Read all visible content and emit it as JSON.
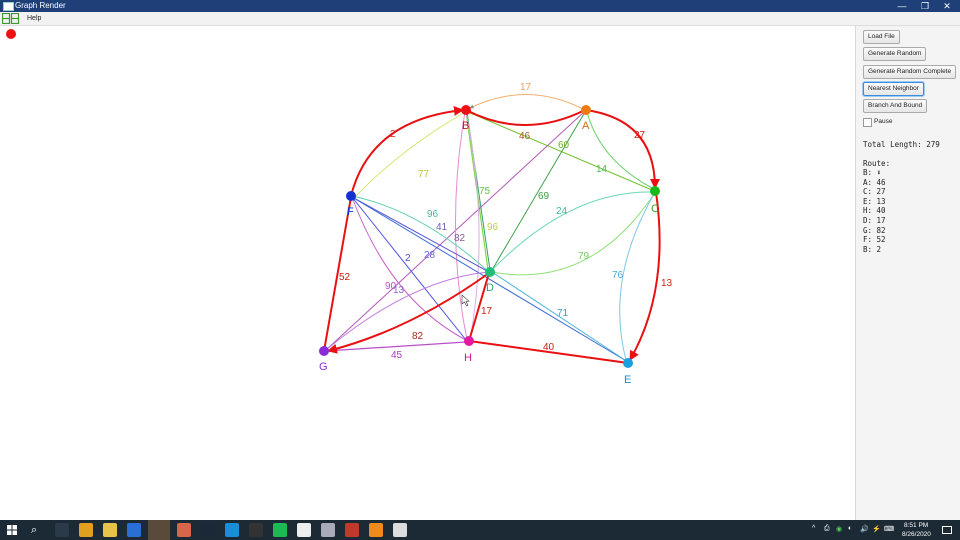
{
  "window": {
    "title": "Graph Render",
    "minimize_glyph": "—",
    "maximize_glyph": "❐",
    "close_glyph": "✕"
  },
  "menu": {
    "help": "Help"
  },
  "graph": {
    "nodes": [
      {
        "id": "B",
        "color": "#ee1111"
      },
      {
        "id": "A",
        "color": "#ef7a12"
      },
      {
        "id": "C",
        "color": "#1ab81a"
      },
      {
        "id": "F",
        "color": "#1530d0"
      },
      {
        "id": "D",
        "color": "#1fbf77"
      },
      {
        "id": "G",
        "color": "#8a2bd6"
      },
      {
        "id": "H",
        "color": "#e21aa0"
      },
      {
        "id": "E",
        "color": "#1a9fdf"
      }
    ],
    "edge_labels": [
      "17",
      "2",
      "46",
      "60",
      "27",
      "14",
      "77",
      "75",
      "69",
      "96",
      "41",
      "82",
      "96",
      "24",
      "2",
      "28",
      "79",
      "76",
      "52",
      "90",
      "13",
      "17",
      "82",
      "71",
      "13",
      "45",
      "40"
    ],
    "indicator_color": "#ee1111"
  },
  "panel": {
    "buttons": {
      "load_file": "Load File",
      "generate_random": "Generate Random",
      "generate_random_complete": "Generate Random Complete",
      "nearest_neighbor": "Nearest Neighbor",
      "branch_and_bound": "Branch And Bound"
    },
    "pause_label": "Pause",
    "pause_checked": false,
    "total_length_label": "Total Length:",
    "total_length": "279",
    "route_label": "Route:",
    "route": [
      {
        "node": "B:",
        "cost": "⬇"
      },
      {
        "node": "A:",
        "cost": "46"
      },
      {
        "node": "C:",
        "cost": "27"
      },
      {
        "node": "E:",
        "cost": "13"
      },
      {
        "node": "H:",
        "cost": "40"
      },
      {
        "node": "D:",
        "cost": "17"
      },
      {
        "node": "G:",
        "cost": "82"
      },
      {
        "node": "F:",
        "cost": "52"
      },
      {
        "node": "B:",
        "cost": "2"
      }
    ]
  },
  "taskbar": {
    "search_glyph": "⌕",
    "clock_time": "8:51 PM",
    "clock_date": "8/26/2020",
    "tray_glyphs": [
      "^",
      "⎙",
      "◉",
      "◐",
      "🔊",
      "⚡",
      "⌨"
    ],
    "app_icons": [
      {
        "name": "task-view-icon",
        "color": "#2b3a48"
      },
      {
        "name": "chrome-icon",
        "color": "#e0a020"
      },
      {
        "name": "file-explorer-icon",
        "color": "#e8c34a"
      },
      {
        "name": "mail-icon",
        "color": "#2a6fd6"
      },
      {
        "name": "vpn-icon",
        "color": "#cfd6dd"
      },
      {
        "name": "snipping-tool-icon",
        "color": "#d8664a"
      },
      {
        "name": "steam-icon",
        "color": "#1b2838"
      },
      {
        "name": "cloud-icon",
        "color": "#1a8fd8"
      },
      {
        "name": "epic-games-icon",
        "color": "#333"
      },
      {
        "name": "spotify-icon",
        "color": "#1db954"
      },
      {
        "name": "store-icon",
        "color": "#eee"
      },
      {
        "name": "printer-icon",
        "color": "#aab"
      },
      {
        "name": "media-player-icon",
        "color": "#c0392b"
      },
      {
        "name": "sublime-icon",
        "color": "#f08a1c"
      },
      {
        "name": "java-icon",
        "color": "#ddd"
      }
    ]
  }
}
